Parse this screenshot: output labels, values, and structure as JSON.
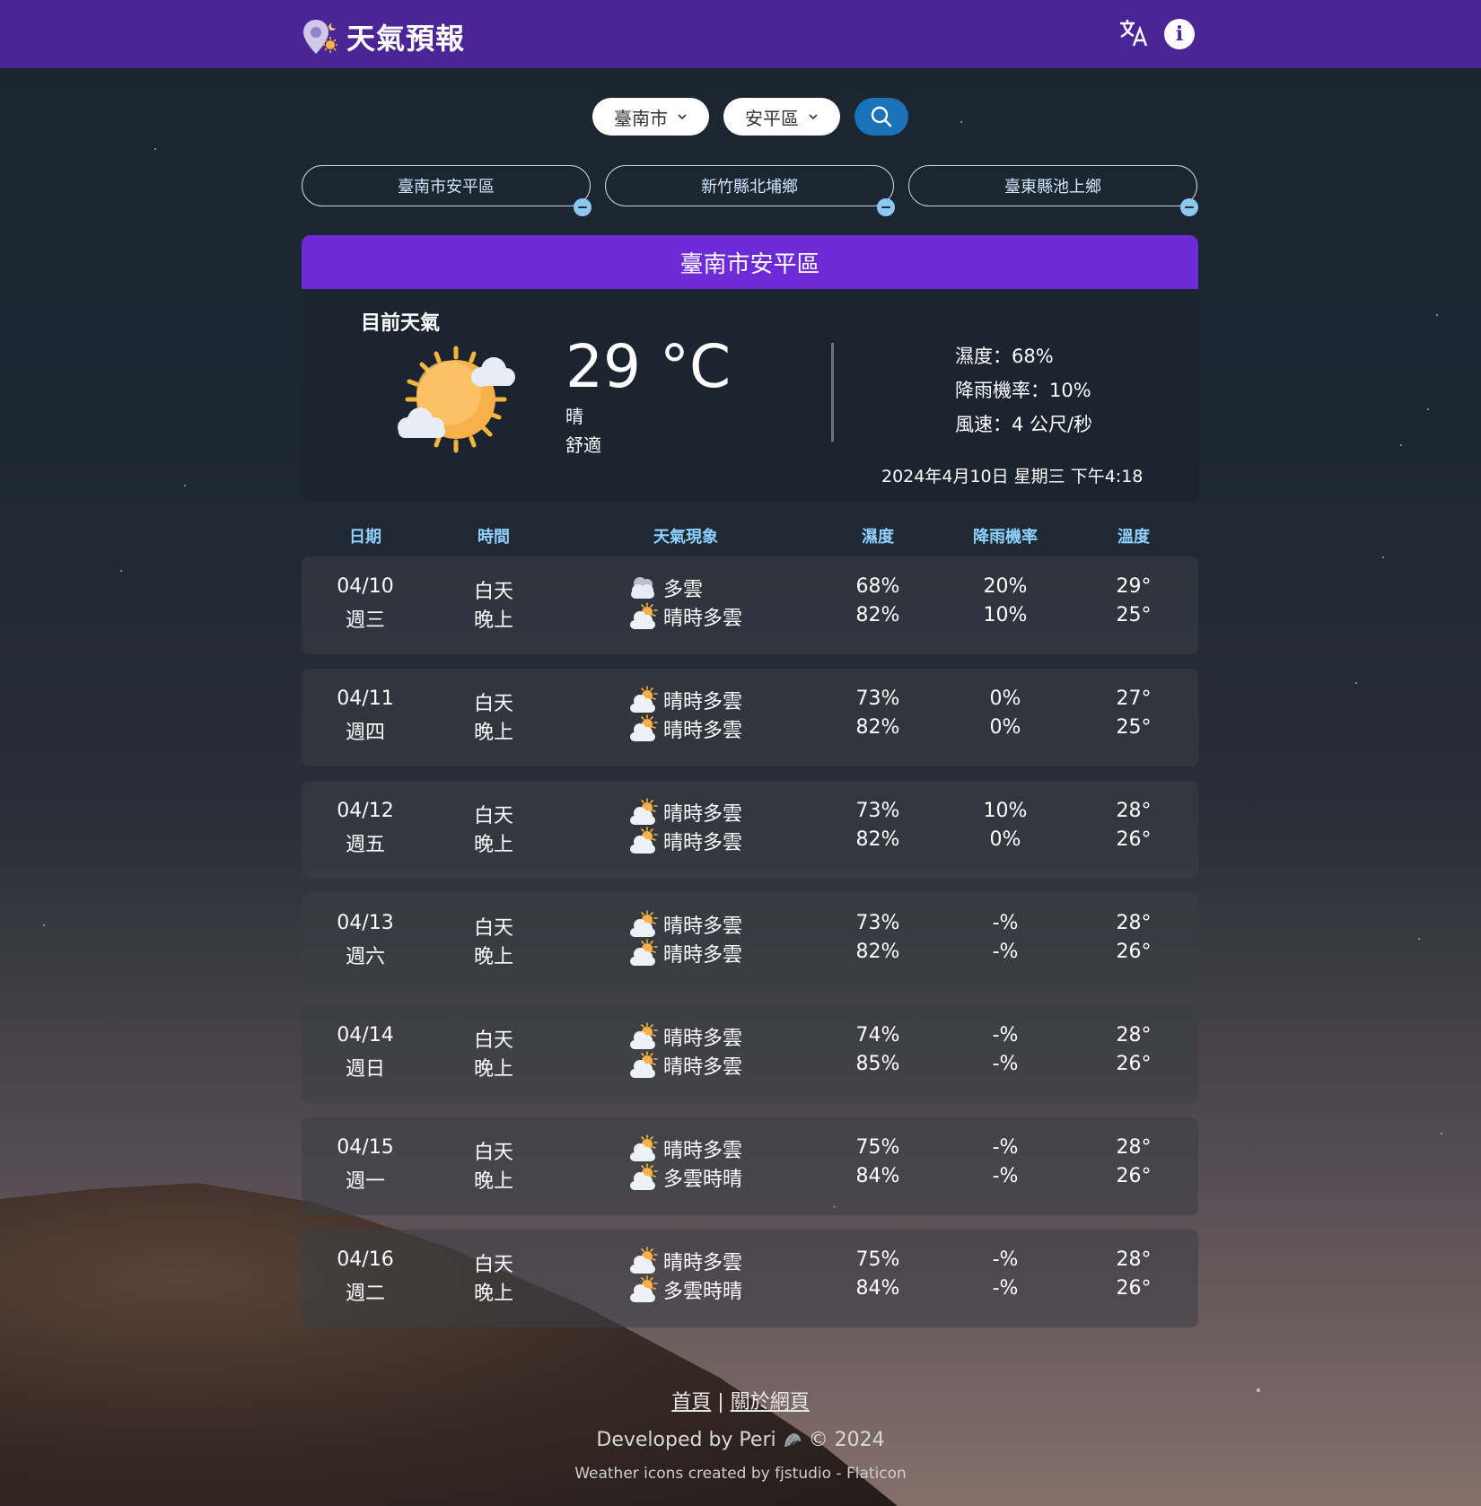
{
  "app": {
    "title": "天氣預報"
  },
  "header": {
    "translate_icon": "translate-icon",
    "info_icon": "info-icon",
    "info_glyph": "i"
  },
  "search": {
    "city": "臺南市",
    "district": "安平區"
  },
  "favorites": [
    {
      "label": "臺南市安平區"
    },
    {
      "label": "新竹縣北埔鄉"
    },
    {
      "label": "臺東縣池上鄉"
    }
  ],
  "current": {
    "location": "臺南市安平區",
    "section_label": "目前天氣",
    "temperature": "29 °C",
    "condition": "晴",
    "comfort": "舒適",
    "humidity": "濕度：68%",
    "rain_chance": "降雨機率：10%",
    "wind": "風速：4 公尺/秒",
    "datetime": "2024年4月10日 星期三 下午4:18"
  },
  "table": {
    "headers": {
      "date": "日期",
      "time": "時間",
      "weather": "天氣現象",
      "humidity": "濕度",
      "rain": "降雨機率",
      "temp": "溫度"
    },
    "rows": [
      {
        "date": "04/10",
        "weekday": "週三",
        "day_label": "白天",
        "night_label": "晚上",
        "day_wx": "多雲",
        "night_wx": "晴時多雲",
        "day_icon": "cloudy-icon",
        "night_icon": "partly-cloudy-icon",
        "day_hum": "68%",
        "night_hum": "82%",
        "day_rain": "20%",
        "night_rain": "10%",
        "day_temp": "29°",
        "night_temp": "25°"
      },
      {
        "date": "04/11",
        "weekday": "週四",
        "day_label": "白天",
        "night_label": "晚上",
        "day_wx": "晴時多雲",
        "night_wx": "晴時多雲",
        "day_icon": "partly-cloudy-icon",
        "night_icon": "partly-cloudy-icon",
        "day_hum": "73%",
        "night_hum": "82%",
        "day_rain": "0%",
        "night_rain": "0%",
        "day_temp": "27°",
        "night_temp": "25°"
      },
      {
        "date": "04/12",
        "weekday": "週五",
        "day_label": "白天",
        "night_label": "晚上",
        "day_wx": "晴時多雲",
        "night_wx": "晴時多雲",
        "day_icon": "partly-cloudy-icon",
        "night_icon": "partly-cloudy-icon",
        "day_hum": "73%",
        "night_hum": "82%",
        "day_rain": "10%",
        "night_rain": "0%",
        "day_temp": "28°",
        "night_temp": "26°"
      },
      {
        "date": "04/13",
        "weekday": "週六",
        "day_label": "白天",
        "night_label": "晚上",
        "day_wx": "晴時多雲",
        "night_wx": "晴時多雲",
        "day_icon": "partly-cloudy-icon",
        "night_icon": "partly-cloudy-icon",
        "day_hum": "73%",
        "night_hum": "82%",
        "day_rain": "-%",
        "night_rain": "-%",
        "day_temp": "28°",
        "night_temp": "26°"
      },
      {
        "date": "04/14",
        "weekday": "週日",
        "day_label": "白天",
        "night_label": "晚上",
        "day_wx": "晴時多雲",
        "night_wx": "晴時多雲",
        "day_icon": "partly-cloudy-icon",
        "night_icon": "partly-cloudy-icon",
        "day_hum": "74%",
        "night_hum": "85%",
        "day_rain": "-%",
        "night_rain": "-%",
        "day_temp": "28°",
        "night_temp": "26°"
      },
      {
        "date": "04/15",
        "weekday": "週一",
        "day_label": "白天",
        "night_label": "晚上",
        "day_wx": "晴時多雲",
        "night_wx": "多雲時晴",
        "day_icon": "partly-cloudy-icon",
        "night_icon": "partly-cloudy-icon",
        "day_hum": "75%",
        "night_hum": "84%",
        "day_rain": "-%",
        "night_rain": "-%",
        "day_temp": "28°",
        "night_temp": "26°"
      },
      {
        "date": "04/16",
        "weekday": "週二",
        "day_label": "白天",
        "night_label": "晚上",
        "day_wx": "晴時多雲",
        "night_wx": "多雲時晴",
        "day_icon": "partly-cloudy-icon",
        "night_icon": "partly-cloudy-icon",
        "day_hum": "75%",
        "night_hum": "84%",
        "day_rain": "-%",
        "night_rain": "-%",
        "day_temp": "28°",
        "night_temp": "26°"
      }
    ]
  },
  "footer": {
    "home_link": "首頁",
    "separator": "|",
    "about_link": "關於網頁",
    "developed": "Developed by Peri",
    "copyright": "© 2024",
    "credit": "Weather icons created by fjstudio - Flaticon"
  },
  "colors": {
    "header_bg": "#4a2596",
    "card_header": "#6d2ad6",
    "accent_blue": "#1a73b8",
    "table_header_text": "#8ed0ff"
  }
}
